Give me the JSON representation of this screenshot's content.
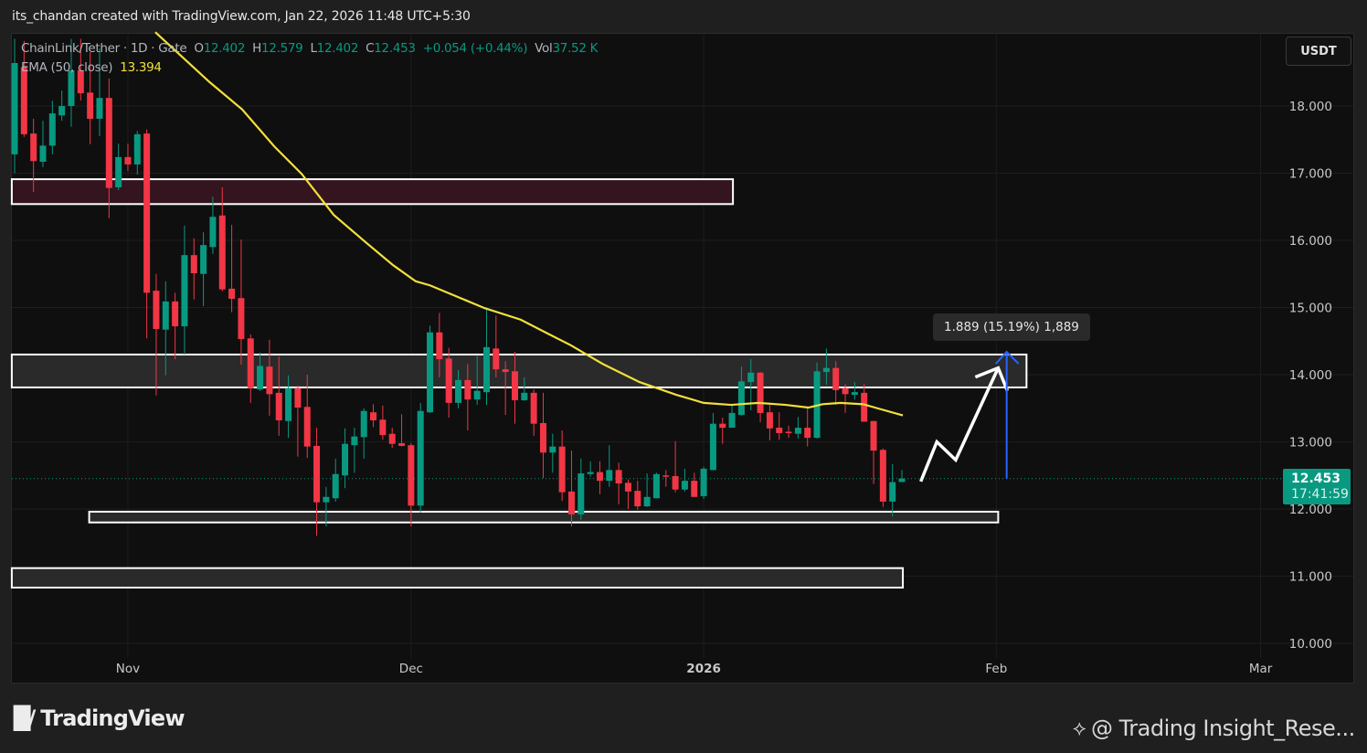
{
  "header": {
    "attribution": "its_chandan created with TradingView.com, Jan 22, 2026 11:48 UTC+5:30"
  },
  "legend": {
    "symbol": "ChainLink/Tether · 1D · Gate",
    "open_label": "O",
    "open": "12.402",
    "high_label": "H",
    "high": "12.579",
    "low_label": "L",
    "low": "12.402",
    "close_label": "C",
    "close": "12.453",
    "change": "+0.054 (+0.44%)",
    "vol_label": "Vol",
    "vol": "37.52 K",
    "ema_label": "EMA (50, close)",
    "ema_value": "13.394"
  },
  "currency_button": "USDT",
  "price_tag": {
    "price": "12.453",
    "countdown": "17:41:59"
  },
  "measure_label": "1.889 (15.19%) 1,889",
  "footer": {
    "logo_text": "TradingView",
    "watermark": "@ Trading Insight_Rese..."
  },
  "colors": {
    "up": "#089981",
    "down": "#f23645",
    "ema": "#f2e03a",
    "measure": "#2962ff",
    "zone_red": "#34141f",
    "zone_gray": "#2a2a2a"
  },
  "chart_data": {
    "type": "candlestick",
    "title": "ChainLink/Tether · 1D · Gate",
    "first_date": "2025-10-20",
    "ylim": [
      9.5,
      19.2
    ],
    "y_ticks": [
      "10.000",
      "11.000",
      "12.000",
      "13.000",
      "14.000",
      "15.000",
      "16.000",
      "17.000",
      "18.000"
    ],
    "x_ticks": [
      {
        "label": "Nov",
        "day": 13,
        "bold": false
      },
      {
        "label": "Dec",
        "day": 43,
        "bold": false
      },
      {
        "label": "2026",
        "day": 74,
        "bold": true
      },
      {
        "label": "Feb",
        "day": 105,
        "bold": false
      },
      {
        "label": "Mar",
        "day": 133,
        "bold": false
      }
    ],
    "ohlc_fields": [
      "open",
      "high",
      "low",
      "close"
    ],
    "candles": [
      [
        17.28,
        19.0,
        17.0,
        18.64
      ],
      [
        18.58,
        18.97,
        17.54,
        17.58
      ],
      [
        17.59,
        17.81,
        16.72,
        17.18
      ],
      [
        17.17,
        17.78,
        17.09,
        17.41
      ],
      [
        17.41,
        18.08,
        17.28,
        17.89
      ],
      [
        17.86,
        18.23,
        17.78,
        18.0
      ],
      [
        18.0,
        19.0,
        17.69,
        18.53
      ],
      [
        18.53,
        19.0,
        18.08,
        18.19
      ],
      [
        18.2,
        18.8,
        17.43,
        17.81
      ],
      [
        17.81,
        18.86,
        17.55,
        18.12
      ],
      [
        18.12,
        18.41,
        16.33,
        16.78
      ],
      [
        16.79,
        17.44,
        16.75,
        17.24
      ],
      [
        17.24,
        17.44,
        17.03,
        17.13
      ],
      [
        17.13,
        17.63,
        16.98,
        17.58
      ],
      [
        17.59,
        17.65,
        14.54,
        15.22
      ],
      [
        15.25,
        15.5,
        13.69,
        14.68
      ],
      [
        14.67,
        15.39,
        13.99,
        15.09
      ],
      [
        15.09,
        15.22,
        14.23,
        14.72
      ],
      [
        14.72,
        16.22,
        14.3,
        15.78
      ],
      [
        15.78,
        16.03,
        15.12,
        15.51
      ],
      [
        15.5,
        16.12,
        15.02,
        15.93
      ],
      [
        15.9,
        16.65,
        15.8,
        16.35
      ],
      [
        16.37,
        16.79,
        15.24,
        15.27
      ],
      [
        15.28,
        16.23,
        14.93,
        15.13
      ],
      [
        15.14,
        16.01,
        14.15,
        14.53
      ],
      [
        14.54,
        14.6,
        13.58,
        13.8
      ],
      [
        13.78,
        14.33,
        13.76,
        14.13
      ],
      [
        14.12,
        14.52,
        13.39,
        13.71
      ],
      [
        13.73,
        14.27,
        13.09,
        13.32
      ],
      [
        13.31,
        13.99,
        13.06,
        13.8
      ],
      [
        13.8,
        13.84,
        12.78,
        13.51
      ],
      [
        13.52,
        14.0,
        12.76,
        12.93
      ],
      [
        12.94,
        13.21,
        11.6,
        12.1
      ],
      [
        12.1,
        12.33,
        11.74,
        12.18
      ],
      [
        12.16,
        12.75,
        12.11,
        12.52
      ],
      [
        12.5,
        13.2,
        12.31,
        12.97
      ],
      [
        12.95,
        13.21,
        12.54,
        13.08
      ],
      [
        13.07,
        13.5,
        12.75,
        13.46
      ],
      [
        13.44,
        13.56,
        13.22,
        13.32
      ],
      [
        13.33,
        13.54,
        13.03,
        13.1
      ],
      [
        13.12,
        13.21,
        12.91,
        12.97
      ],
      [
        12.98,
        13.41,
        12.93,
        12.94
      ],
      [
        12.95,
        12.98,
        11.74,
        12.05
      ],
      [
        12.05,
        13.58,
        11.95,
        13.46
      ],
      [
        13.44,
        14.73,
        13.43,
        14.63
      ],
      [
        14.63,
        14.92,
        13.96,
        14.23
      ],
      [
        14.24,
        14.4,
        13.36,
        13.58
      ],
      [
        13.58,
        14.07,
        13.5,
        13.92
      ],
      [
        13.92,
        14.16,
        13.17,
        13.63
      ],
      [
        13.63,
        14.29,
        13.55,
        13.76
      ],
      [
        13.74,
        15.0,
        13.55,
        14.41
      ],
      [
        14.39,
        14.88,
        13.96,
        14.08
      ],
      [
        14.08,
        14.2,
        13.4,
        14.04
      ],
      [
        14.05,
        14.34,
        13.27,
        13.62
      ],
      [
        13.62,
        13.96,
        13.61,
        13.73
      ],
      [
        13.73,
        13.78,
        13.09,
        13.27
      ],
      [
        13.28,
        13.73,
        12.46,
        12.84
      ],
      [
        12.84,
        13.12,
        12.54,
        12.93
      ],
      [
        12.93,
        13.17,
        12.12,
        12.25
      ],
      [
        12.26,
        12.87,
        11.74,
        11.92
      ],
      [
        11.92,
        12.75,
        11.84,
        12.53
      ],
      [
        12.52,
        12.71,
        12.48,
        12.55
      ],
      [
        12.55,
        12.71,
        12.22,
        12.42
      ],
      [
        12.42,
        12.95,
        12.33,
        12.58
      ],
      [
        12.58,
        12.69,
        12.07,
        12.38
      ],
      [
        12.39,
        12.44,
        12.0,
        12.26
      ],
      [
        12.27,
        12.42,
        11.99,
        12.04
      ],
      [
        12.04,
        12.53,
        12.03,
        12.18
      ],
      [
        12.16,
        12.54,
        12.16,
        12.52
      ],
      [
        12.5,
        12.58,
        12.33,
        12.48
      ],
      [
        12.49,
        13.01,
        12.25,
        12.29
      ],
      [
        12.29,
        12.6,
        12.26,
        12.42
      ],
      [
        12.42,
        12.54,
        12.18,
        12.18
      ],
      [
        12.19,
        12.63,
        12.15,
        12.6
      ],
      [
        12.58,
        13.43,
        12.58,
        13.27
      ],
      [
        13.27,
        13.36,
        12.97,
        13.21
      ],
      [
        13.21,
        13.56,
        13.21,
        13.43
      ],
      [
        13.4,
        14.12,
        13.39,
        13.9
      ],
      [
        13.89,
        14.23,
        13.47,
        14.03
      ],
      [
        14.03,
        14.04,
        13.29,
        13.43
      ],
      [
        13.44,
        13.55,
        13.02,
        13.2
      ],
      [
        13.21,
        13.44,
        13.03,
        13.13
      ],
      [
        13.15,
        13.24,
        13.06,
        13.14
      ],
      [
        13.12,
        13.37,
        13.05,
        13.21
      ],
      [
        13.21,
        13.51,
        12.93,
        13.06
      ],
      [
        13.06,
        14.18,
        13.05,
        14.05
      ],
      [
        14.04,
        14.39,
        13.85,
        14.1
      ],
      [
        14.1,
        14.2,
        13.55,
        13.77
      ],
      [
        13.8,
        13.86,
        13.43,
        13.71
      ],
      [
        13.7,
        13.89,
        13.63,
        13.74
      ],
      [
        13.73,
        13.86,
        13.3,
        13.3
      ],
      [
        13.31,
        13.31,
        12.37,
        12.87
      ],
      [
        12.88,
        12.9,
        12.03,
        12.11
      ],
      [
        12.11,
        12.67,
        11.89,
        12.4
      ],
      [
        12.402,
        12.579,
        12.402,
        12.453
      ]
    ],
    "ema50": {
      "name": "EMA (50, close)",
      "points": [
        [
          15.9,
          19.1
        ],
        [
          21.7,
          18.35
        ],
        [
          25.1,
          17.95
        ],
        [
          28.5,
          17.4
        ],
        [
          31.4,
          16.99
        ],
        [
          34.8,
          16.38
        ],
        [
          38.2,
          15.97
        ],
        [
          41.1,
          15.63
        ],
        [
          43.5,
          15.39
        ],
        [
          45.0,
          15.33
        ],
        [
          47.9,
          15.16
        ],
        [
          50.8,
          14.99
        ],
        [
          54.6,
          14.82
        ],
        [
          57.5,
          14.61
        ],
        [
          59.9,
          14.44
        ],
        [
          63.3,
          14.16
        ],
        [
          67.2,
          13.89
        ],
        [
          71.1,
          13.7
        ],
        [
          74.0,
          13.58
        ],
        [
          76.9,
          13.55
        ],
        [
          79.8,
          13.58
        ],
        [
          82.7,
          13.55
        ],
        [
          85.1,
          13.51
        ],
        [
          86.6,
          13.56
        ],
        [
          88.5,
          13.58
        ],
        [
          90.9,
          13.56
        ],
        [
          92.4,
          13.5
        ],
        [
          95.1,
          13.394
        ]
      ]
    },
    "zones": [
      {
        "name": "resistance-zone-upper",
        "from_day": 0.7,
        "to_day": 77.1,
        "top": 16.91,
        "bottom": 16.54,
        "fill": "zone_red"
      },
      {
        "name": "resistance-zone-mid",
        "from_day": 0.7,
        "to_day": 108.2,
        "top": 14.3,
        "bottom": 13.81,
        "fill": "zone_gray"
      },
      {
        "name": "support-zone",
        "from_day": 8.9,
        "to_day": 105.2,
        "top": 11.96,
        "bottom": 11.8,
        "fill": "zone_gray"
      },
      {
        "name": "support-zone-lower",
        "from_day": 0.7,
        "to_day": 95.1,
        "top": 11.12,
        "bottom": 10.83,
        "fill": "zone_gray"
      }
    ],
    "projection_path": [
      [
        97.0,
        12.41
      ],
      [
        98.7,
        13.0
      ],
      [
        100.7,
        12.73
      ],
      [
        105.2,
        14.1
      ]
    ],
    "measure": {
      "day": 106.1,
      "from": 12.45,
      "to": 14.34,
      "label": "1.889 (15.19%) 1,889"
    },
    "last_price": 12.453
  }
}
